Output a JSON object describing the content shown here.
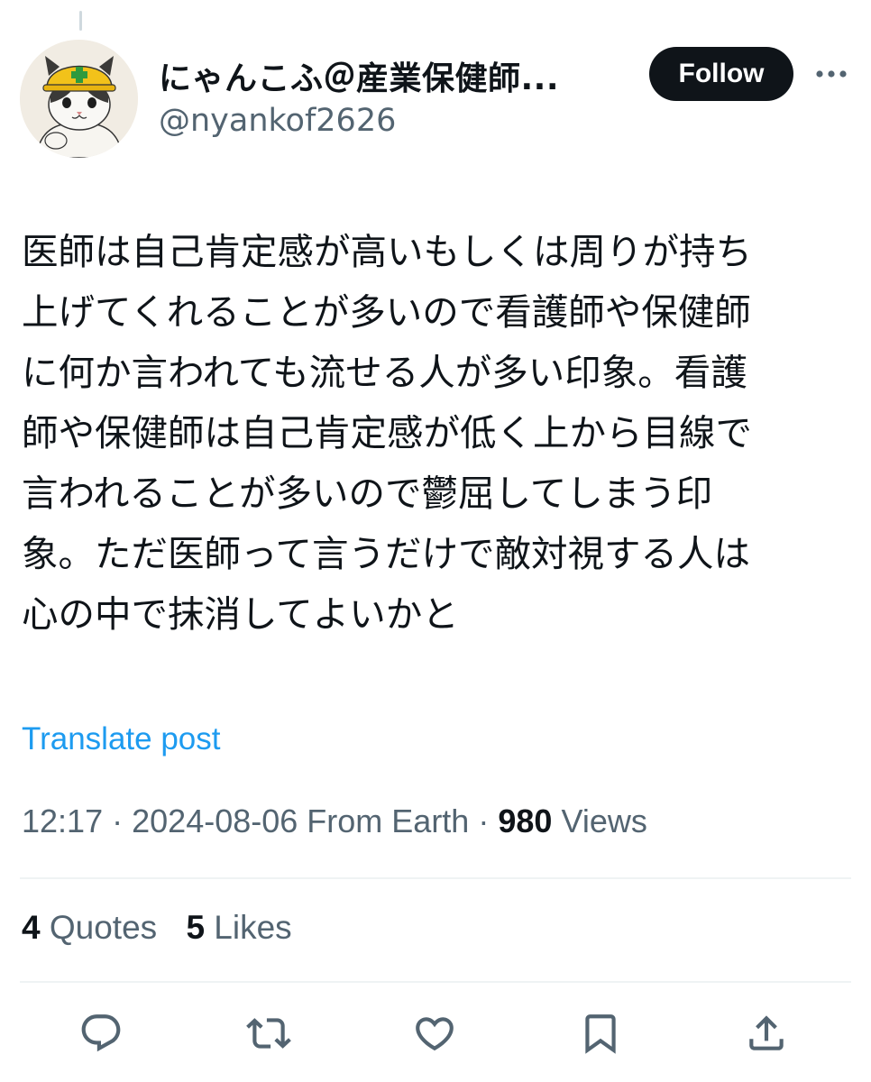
{
  "author": {
    "display_name": "にゃんこふ＠産業保健師...",
    "handle": "@nyankof2626"
  },
  "follow_label": "Follow",
  "tweet_text": "医師は自己肯定感が高いもしくは周りが持ち\n上げてくれることが多いので看護師や保健師\nに何か言われても流せる人が多い印象。看護\n師や保健師は自己肯定感が低く上から目線で\n言われることが多いので鬱屈してしまう印\n象。ただ医師って言うだけで敵対視する人は\n心の中で抹消してよいかと",
  "translate_label": "Translate post",
  "meta": {
    "time": "12:17",
    "date": "2024-08-06",
    "source": "From Earth",
    "separator": "·",
    "views_count": "980",
    "views_label": "Views"
  },
  "stats": {
    "quotes_count": "4",
    "quotes_label": "Quotes",
    "likes_count": "5",
    "likes_label": "Likes"
  },
  "icons": {
    "more": "more-dots-icon",
    "reply": "reply-icon",
    "retweet": "retweet-icon",
    "like": "heart-icon",
    "bookmark": "bookmark-icon",
    "share": "share-icon"
  },
  "colors": {
    "text": "#0f1419",
    "secondary": "#536471",
    "link": "#1d9bf0",
    "follow_bg": "#0f1419",
    "divider": "#eff3f4"
  }
}
